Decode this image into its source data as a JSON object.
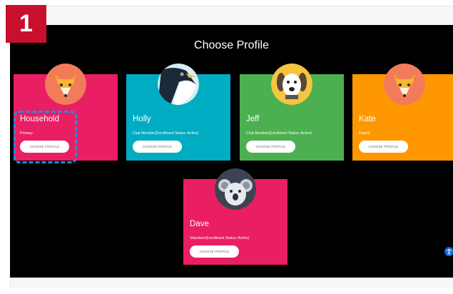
{
  "step": {
    "number": "1"
  },
  "header": {
    "title": "Choose Profile"
  },
  "colors": {
    "household": "#e91e63",
    "holly": "#00acc1",
    "jeff": "#4caf50",
    "kate": "#ff9800",
    "dave": "#e91e63",
    "highlight": "#1e8fe0",
    "step_badge": "#c8102e"
  },
  "profiles": [
    {
      "name": "Household",
      "role": "Primary",
      "button": "CHOOSE PROFILE",
      "avatar": "fox-icon"
    },
    {
      "name": "Holly",
      "role": "Club Member(Enrollment Status: Active)",
      "button": "CHOOSE PROFILE",
      "avatar": "penguin-icon"
    },
    {
      "name": "Jeff",
      "role": "Club Member(Enrollment Status: Active)",
      "button": "CHOOSE PROFILE",
      "avatar": "dog-icon"
    },
    {
      "name": "Kate",
      "role": "Parent",
      "button": "CHOOSE PROFILE",
      "avatar": "fox-icon"
    },
    {
      "name": "Dave",
      "role": "Volunteer(Enrollment Status: Active)",
      "button": "CHOOSE PROFILE",
      "avatar": "koala-icon"
    }
  ],
  "accessibility": {
    "icon": "accessibility-icon"
  }
}
